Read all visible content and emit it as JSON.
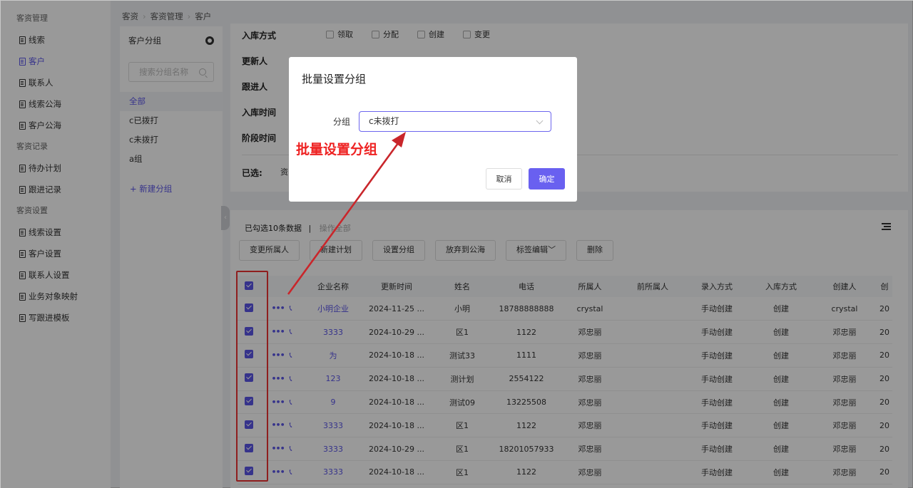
{
  "sidebar": {
    "sections": [
      {
        "title": "客资管理",
        "items": [
          {
            "label": "线索"
          },
          {
            "label": "客户",
            "active": true
          },
          {
            "label": "联系人"
          },
          {
            "label": "线索公海"
          },
          {
            "label": "客户公海"
          }
        ]
      },
      {
        "title": "客资记录",
        "items": [
          {
            "label": "待办计划"
          },
          {
            "label": "跟进记录"
          }
        ]
      },
      {
        "title": "客资设置",
        "items": [
          {
            "label": "线索设置"
          },
          {
            "label": "客户设置"
          },
          {
            "label": "联系人设置"
          },
          {
            "label": "业务对象映射"
          },
          {
            "label": "写跟进模板"
          }
        ]
      }
    ]
  },
  "breadcrumb": [
    "客资",
    "客资管理",
    "客户"
  ],
  "groups": {
    "title": "客户分组",
    "search_placeholder": "搜索分组名称",
    "items": [
      {
        "label": "全部",
        "active": true
      },
      {
        "label": "c已拨打"
      },
      {
        "label": "c未拨打"
      },
      {
        "label": "a组"
      }
    ],
    "add_label": "+ 新建分组"
  },
  "filters": {
    "stock_way": {
      "label": "入库方式",
      "options": [
        "领取",
        "分配",
        "创建",
        "变更"
      ]
    },
    "updater": "更新人",
    "follower": "跟进人",
    "stock_time": "入库时间",
    "stage_time": "阶段时间",
    "selected_label": "已选:",
    "selected_value": "资"
  },
  "table": {
    "summary": "已勾选10条数据",
    "summary_sep": "|",
    "summary_action": "操作全部",
    "buttons": [
      "变更所属人",
      "新建计划",
      "设置分组",
      "放弃到公海",
      "标签编辑﹀",
      "删除"
    ],
    "columns": [
      "",
      "",
      "企业名称",
      "更新时间",
      "姓名",
      "电话",
      "所属人",
      "前所属人",
      "录入方式",
      "入库方式",
      "创建人",
      "创"
    ],
    "rows": [
      {
        "company": "小明企业",
        "updated": "2024-11-25 ...",
        "name": "小明",
        "phone": "18788888888",
        "owner": "crystal",
        "prev_owner": "",
        "entry": "手动创建",
        "stock": "创建",
        "creator": "crystal",
        "extra": "20"
      },
      {
        "company": "3333",
        "updated": "2024-10-29 ...",
        "name": "区1",
        "phone": "1122",
        "owner": "邓忠丽",
        "prev_owner": "",
        "entry": "手动创建",
        "stock": "创建",
        "creator": "邓忠丽",
        "extra": "20"
      },
      {
        "company": "为",
        "updated": "2024-10-18 ...",
        "name": "测试33",
        "phone": "1111",
        "owner": "邓忠丽",
        "prev_owner": "",
        "entry": "手动创建",
        "stock": "创建",
        "creator": "邓忠丽",
        "extra": "20"
      },
      {
        "company": "123",
        "updated": "2024-10-18 ...",
        "name": "测计划",
        "phone": "2554122",
        "owner": "邓忠丽",
        "prev_owner": "",
        "entry": "手动创建",
        "stock": "创建",
        "creator": "邓忠丽",
        "extra": "20"
      },
      {
        "company": "9",
        "updated": "2024-10-18 ...",
        "name": "测试09",
        "phone": "13225508",
        "owner": "邓忠丽",
        "prev_owner": "",
        "entry": "手动创建",
        "stock": "创建",
        "creator": "邓忠丽",
        "extra": "20"
      },
      {
        "company": "3333",
        "updated": "2024-10-18 ...",
        "name": "区1",
        "phone": "1122",
        "owner": "邓忠丽",
        "prev_owner": "",
        "entry": "手动创建",
        "stock": "创建",
        "creator": "邓忠丽",
        "extra": "20"
      },
      {
        "company": "3333",
        "updated": "2024-10-29 ...",
        "name": "区1",
        "phone": "18201057933",
        "owner": "邓忠丽",
        "prev_owner": "",
        "entry": "手动创建",
        "stock": "创建",
        "creator": "邓忠丽",
        "extra": "20"
      },
      {
        "company": "3333",
        "updated": "2024-10-18 ...",
        "name": "区1",
        "phone": "1122",
        "owner": "邓忠丽",
        "prev_owner": "",
        "entry": "手动创建",
        "stock": "创建",
        "creator": "邓忠丽",
        "extra": "20"
      }
    ]
  },
  "modal": {
    "title": "批量设置分组",
    "field_label": "分组",
    "field_value": "c未拨打",
    "cancel_label": "取消",
    "ok_label": "确定"
  },
  "annotation": {
    "text": "批量设置分组",
    "color": "#e22222"
  },
  "colors": {
    "accent": "#5b55e8"
  }
}
